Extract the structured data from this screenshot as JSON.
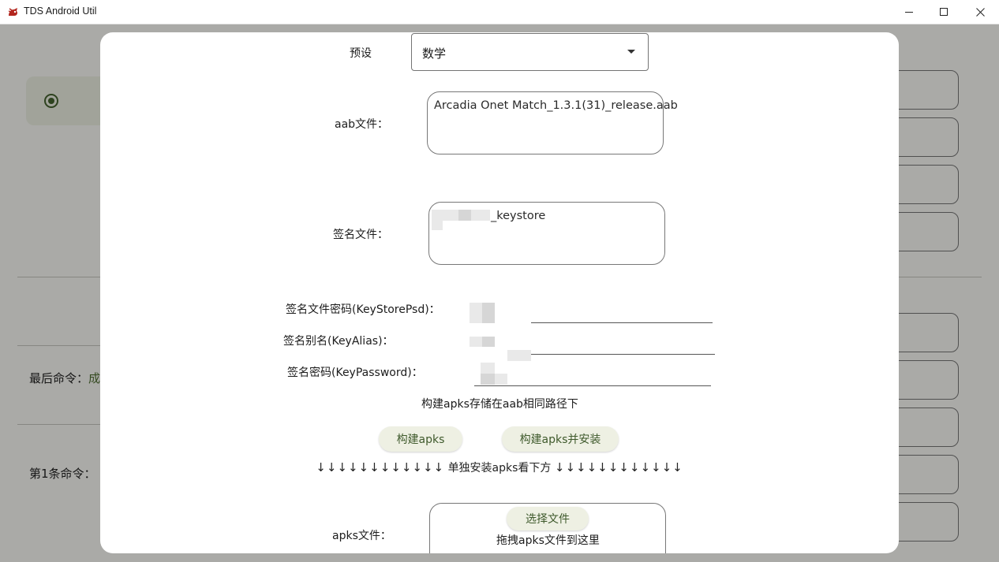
{
  "window": {
    "title": "TDS Android Util"
  },
  "background": {
    "last_command_label": "最后命令：",
    "last_command_status": "成",
    "first_command_label": "第1条命令："
  },
  "dialog": {
    "preset": {
      "label": "预设",
      "value": "数学"
    },
    "aab": {
      "label": "aab文件：",
      "value": "Arcadia Onet Match_1.3.1(31)_release.aab"
    },
    "keystore": {
      "label": "签名文件：",
      "value": "_keystore"
    },
    "keystore_password": {
      "label": "签名文件密码(KeyStorePsd)："
    },
    "key_alias": {
      "label": "签名别名(KeyAlias)："
    },
    "key_password": {
      "label": "签名密码(KeyPassword)："
    },
    "storage_note": "构建apks存储在aab相同路径下",
    "build_apks_label": "构建apks",
    "build_install_label": "构建apks并安装",
    "separator": {
      "arrows_left": "↓↓↓↓↓↓↓↓↓↓↓↓",
      "text": "单独安装apks看下方",
      "arrows_right": "↓↓↓↓↓↓↓↓↓↓↓↓"
    },
    "apks": {
      "label": "apks文件：",
      "select_label": "选择文件",
      "drop_hint": "拖拽apks文件到这里"
    }
  },
  "colors": {
    "accent": "#4e6d32",
    "pill_bg": "#eef0e3",
    "pill_text": "#3f5a2c"
  }
}
